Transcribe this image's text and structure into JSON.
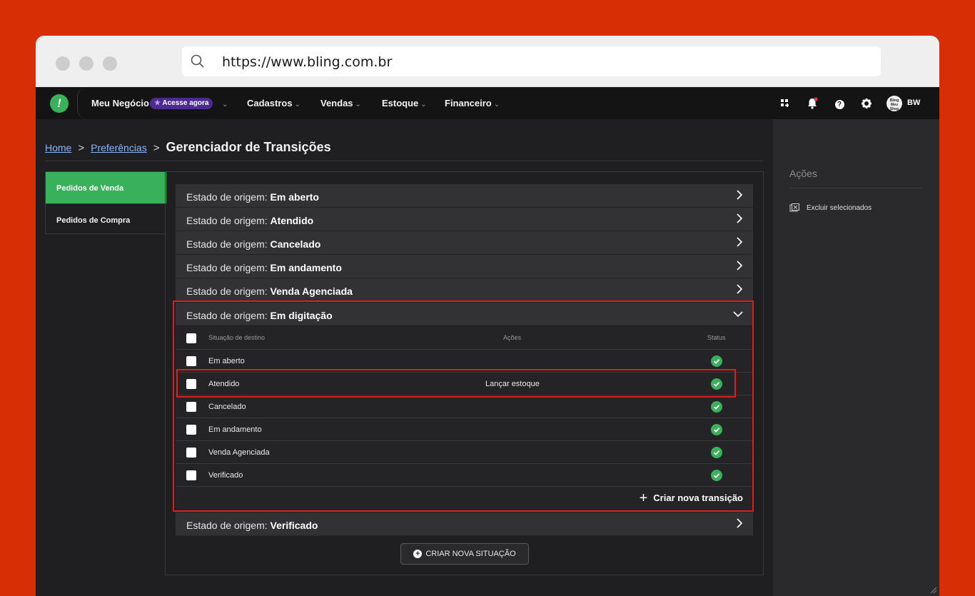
{
  "browser": {
    "url": "https://www.bling.com.br"
  },
  "nav": {
    "logo": "!",
    "items": [
      {
        "label": "Meu Negócio",
        "chevron": "⌄"
      },
      {
        "label": "Cadastros",
        "chevron": "⌄"
      },
      {
        "label": "Vendas",
        "chevron": "⌄"
      },
      {
        "label": "Estoque",
        "chevron": "⌄"
      },
      {
        "label": "Financeiro",
        "chevron": "⌄"
      }
    ],
    "badge": "Acesse agora",
    "badge_chevron": "⌄",
    "help": "?",
    "avatar_text": "Bling Meu Shop",
    "user_initials": "BW"
  },
  "breadcrumb": {
    "home": "Home",
    "sep": ">",
    "preferences": "Preferências",
    "title": "Gerenciador de Transições"
  },
  "tabs": [
    {
      "label": "Pedidos de Venda"
    },
    {
      "label": "Pedidos de Compra"
    }
  ],
  "states": {
    "prefix": "Estado de origem:",
    "collapsed_before": [
      "Em aberto",
      "Atendido",
      "Cancelado",
      "Em andamento",
      "Venda Agenciada"
    ],
    "expanded": "Em digitação",
    "collapsed_after": [
      "Verificado"
    ]
  },
  "table": {
    "headers": {
      "destino": "Situação de destino",
      "acoes": "Ações",
      "status": "Status"
    },
    "rows": [
      {
        "name": "Em aberto",
        "acao": ""
      },
      {
        "name": "Atendido",
        "acao": "Lançar estoque"
      },
      {
        "name": "Cancelado",
        "acao": ""
      },
      {
        "name": "Em andamento",
        "acao": ""
      },
      {
        "name": "Venda Agenciada",
        "acao": ""
      },
      {
        "name": "Verificado",
        "acao": ""
      }
    ],
    "create_label": "Criar nova transição",
    "create_icon": "+"
  },
  "new_situation": {
    "icon": "+",
    "label": "CRIAR NOVA SITUAÇÃO"
  },
  "side_panel": {
    "title": "Ações",
    "action": "Excluir selecionados"
  },
  "colors": {
    "accent_green": "#39b15a",
    "highlight_red": "#e01c1c",
    "background": "#d82e06",
    "badge": "#4b2b8f"
  }
}
